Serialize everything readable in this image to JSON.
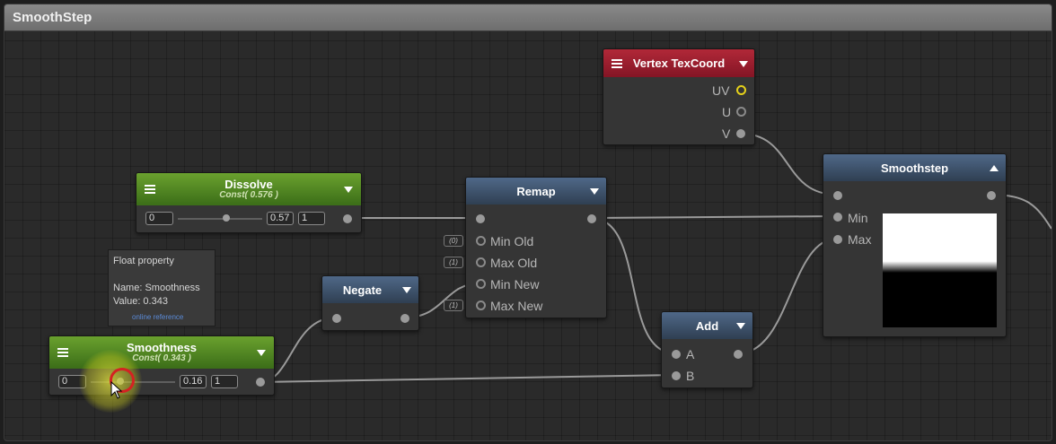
{
  "window": {
    "title": "SmoothStep"
  },
  "colors": {
    "value_node": "#4f8a24",
    "function_node": "#3d536d",
    "vertex_node": "#a1202f",
    "connector": "#9a9a9a",
    "uv_port": "#e5d11a"
  },
  "nodes": {
    "vertex_texcoord": {
      "title": "Vertex TexCoord",
      "outputs": [
        "UV",
        "U",
        "V"
      ]
    },
    "dissolve": {
      "title": "Dissolve",
      "subtitle": "Const( 0.576 )",
      "min": "0",
      "value": "0.57",
      "max": "1",
      "fraction": 0.576
    },
    "remap": {
      "title": "Remap",
      "inputs": [
        "Min Old",
        "Max Old",
        "Min New",
        "Max New"
      ],
      "defaults": [
        "(0)",
        "(1)",
        "(1)"
      ]
    },
    "negate": {
      "title": "Negate"
    },
    "smoothness": {
      "title": "Smoothness",
      "subtitle": "Const( 0.343 )",
      "min": "0",
      "value": "0.16",
      "max": "1",
      "fraction": 0.343
    },
    "add": {
      "title": "Add",
      "inputs": [
        "A",
        "B"
      ]
    },
    "smoothstep": {
      "title": "Smoothstep",
      "inputs": [
        "Min",
        "Max"
      ]
    }
  },
  "tooltip": {
    "line1": "Float property",
    "line2": "Name: Smoothness",
    "line3": "Value: 0.343",
    "link": "online reference"
  },
  "icons": [
    "menu-icon",
    "dropdown-arrow-icon",
    "collapse-arrow-icon",
    "mouse-pointer-icon"
  ]
}
